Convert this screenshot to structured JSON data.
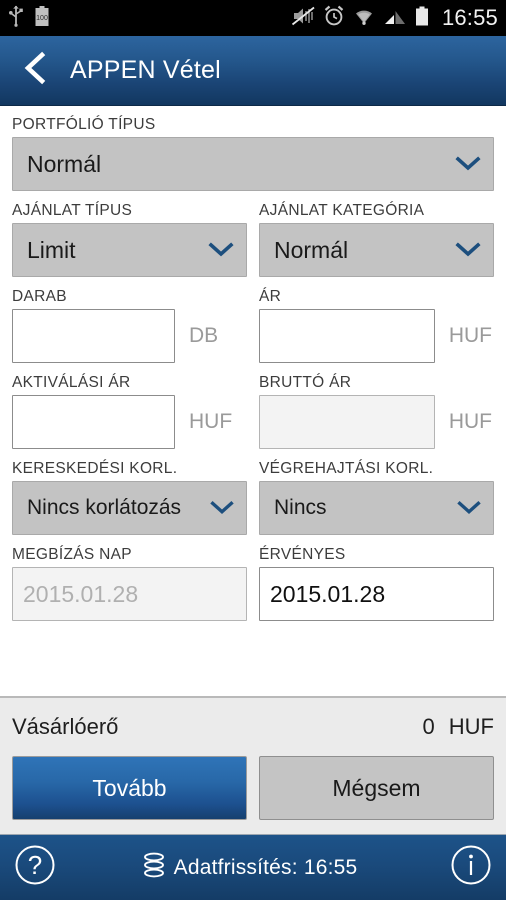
{
  "statusbar": {
    "time": "16:55",
    "left_icons": [
      "usb-icon",
      "battery-level-100-icon"
    ],
    "battery_level_text": "100",
    "right_icons": [
      "mute-vibrate-off-icon",
      "alarm-clock-icon",
      "wifi-icon",
      "signal-bars-icon",
      "battery-full-icon"
    ]
  },
  "header": {
    "back_icon": "chevron-left-icon",
    "title": "APPEN Vétel",
    "background_color": "#24578c"
  },
  "form": {
    "portfolio_type": {
      "label": "PORTFÓLIÓ TÍPUS",
      "value": "Normál",
      "type": "select"
    },
    "offer_type": {
      "label": "AJÁNLAT TÍPUS",
      "value": "Limit",
      "type": "select"
    },
    "offer_category": {
      "label": "AJÁNLAT KATEGÓRIA",
      "value": "Normál",
      "type": "select"
    },
    "quantity": {
      "label": "DARAB",
      "value": "",
      "unit": "DB",
      "type": "text"
    },
    "price": {
      "label": "ÁR",
      "value": "",
      "unit": "HUF",
      "type": "text"
    },
    "activation_price": {
      "label": "AKTIVÁLÁSI ÁR",
      "value": "",
      "unit": "HUF",
      "type": "text"
    },
    "gross_price": {
      "label": "BRUTTÓ ÁR",
      "value": "",
      "unit": "HUF",
      "type": "text",
      "disabled": true
    },
    "trading_restriction": {
      "label": "KERESKEDÉSI KORL.",
      "value": "Nincs korlátozás",
      "type": "select"
    },
    "execution_restriction": {
      "label": "VÉGREHAJTÁSI KORL.",
      "value": "Nincs",
      "type": "select"
    },
    "order_day": {
      "label": "MEGBÍZÁS NAP",
      "value": "2015.01.28",
      "type": "text",
      "disabled": true
    },
    "valid_until": {
      "label": "ÉRVÉNYES",
      "value": "2015.01.28",
      "type": "text"
    }
  },
  "summary": {
    "label": "Vásárlóerő",
    "value": "0",
    "currency": "HUF"
  },
  "buttons": {
    "primary_label": "Tovább",
    "secondary_label": "Mégsem",
    "primary_color": "#2868a8"
  },
  "footer": {
    "help_icon": "question-mark-circle-icon",
    "refresh_icon": "database-stack-icon",
    "refresh_text": "Adatfrissítés: 16:55",
    "info_icon": "info-circle-icon"
  }
}
